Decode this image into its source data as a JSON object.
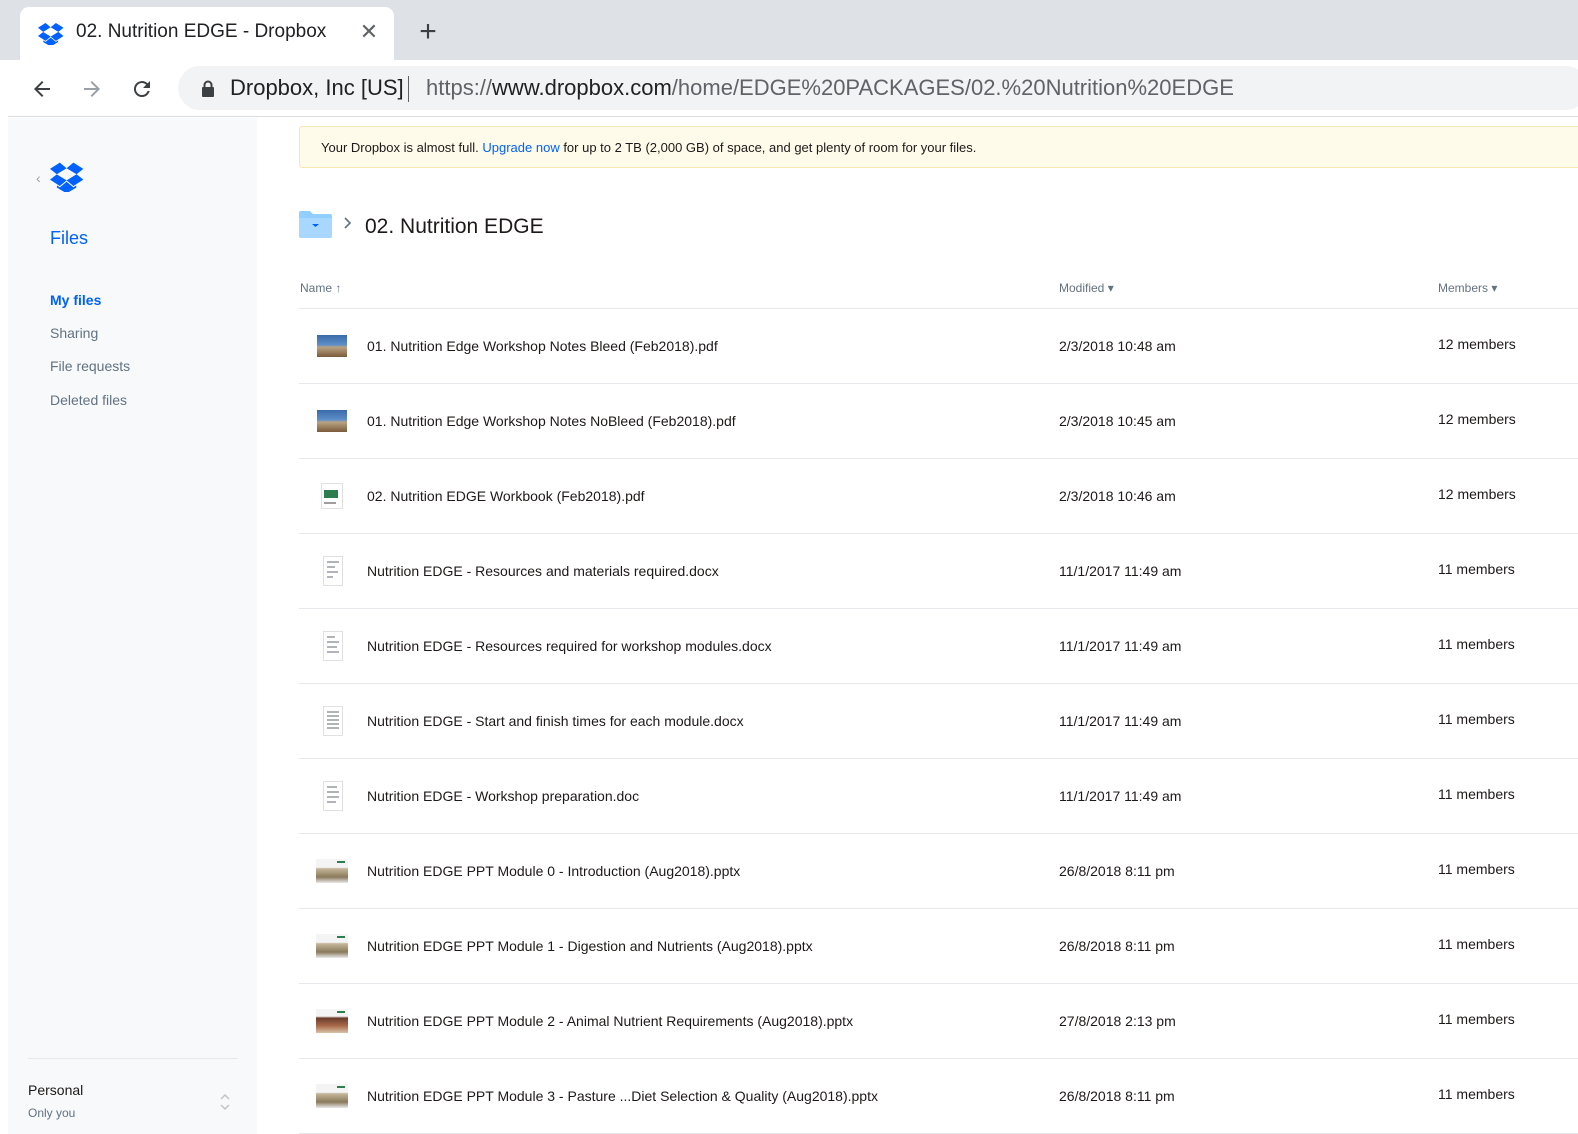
{
  "browser": {
    "tab_title": "02. Nutrition EDGE - Dropbox",
    "close_glyph": "✕",
    "new_tab_glyph": "+",
    "site_identity": "Dropbox, Inc [US]",
    "url_scheme": "https://",
    "url_host": "www.dropbox.com",
    "url_path": "/home/EDGE%20PACKAGES/02.%20Nutrition%20EDGE"
  },
  "sidebar": {
    "back_glyph": "‹",
    "files_label": "Files",
    "items": [
      {
        "label": "My files",
        "active": true
      },
      {
        "label": "Sharing",
        "active": false
      },
      {
        "label": "File requests",
        "active": false
      },
      {
        "label": "Deleted files",
        "active": false
      }
    ],
    "account": {
      "name": "Personal",
      "subtitle": "Only you"
    }
  },
  "banner": {
    "before": "Your Dropbox is almost full. ",
    "link": "Upgrade now",
    "after": " for up to 2 TB (2,000 GB) of space, and get plenty of room for your files."
  },
  "breadcrumb": {
    "title": "02. Nutrition EDGE"
  },
  "table": {
    "columns": {
      "name": "Name ↑",
      "modified": "Modified ▾",
      "members": "Members ▾"
    },
    "rows": [
      {
        "name": "01. Nutrition Edge Workshop Notes Bleed (Feb2018).pdf",
        "modified": "2/3/2018 10:48 am",
        "members": "12 members",
        "thumb": "photo"
      },
      {
        "name": "01. Nutrition Edge Workshop Notes NoBleed (Feb2018).pdf",
        "modified": "2/3/2018 10:45 am",
        "members": "12 members",
        "thumb": "photo"
      },
      {
        "name": "02. Nutrition EDGE Workbook (Feb2018).pdf",
        "modified": "2/3/2018 10:46 am",
        "members": "12 members",
        "thumb": "green"
      },
      {
        "name": "Nutrition EDGE - Resources and materials required.docx",
        "modified": "11/1/2017 11:49 am",
        "members": "11 members",
        "thumb": "doc"
      },
      {
        "name": "Nutrition EDGE - Resources required for workshop modules.docx",
        "modified": "11/1/2017 11:49 am",
        "members": "11 members",
        "thumb": "doc"
      },
      {
        "name": "Nutrition EDGE - Start and finish times for each module.docx",
        "modified": "11/1/2017 11:49 am",
        "members": "11 members",
        "thumb": "doc"
      },
      {
        "name": "Nutrition EDGE - Workshop preparation.doc",
        "modified": "11/1/2017 11:49 am",
        "members": "11 members",
        "thumb": "doc"
      },
      {
        "name": "Nutrition EDGE PPT Module 0 - Introduction (Aug2018).pptx",
        "modified": "26/8/2018 8:11 pm",
        "members": "11 members",
        "thumb": "slide"
      },
      {
        "name": "Nutrition EDGE PPT Module 1 - Digestion and Nutrients (Aug2018).pptx",
        "modified": "26/8/2018 8:11 pm",
        "members": "11 members",
        "thumb": "slide"
      },
      {
        "name": "Nutrition EDGE PPT Module 2 - Animal Nutrient Requirements (Aug2018).pptx",
        "modified": "27/8/2018 2:13 pm",
        "members": "11 members",
        "thumb": "slide2"
      },
      {
        "name": "Nutrition EDGE PPT Module 3 - Pasture ...Diet Selection & Quality (Aug2018).pptx",
        "modified": "26/8/2018 8:11 pm",
        "members": "11 members",
        "thumb": "slide"
      }
    ]
  },
  "colors": {
    "accent": "#0061fe",
    "banner_bg": "#fffbea",
    "sidebar_bg": "#f7f9fa"
  },
  "icons": [
    "dropbox-icon",
    "close-icon",
    "plus-icon",
    "back-arrow-icon",
    "forward-arrow-icon",
    "reload-icon",
    "lock-icon",
    "folder-icon",
    "chevron-right-icon",
    "sort-updown-icon"
  ]
}
